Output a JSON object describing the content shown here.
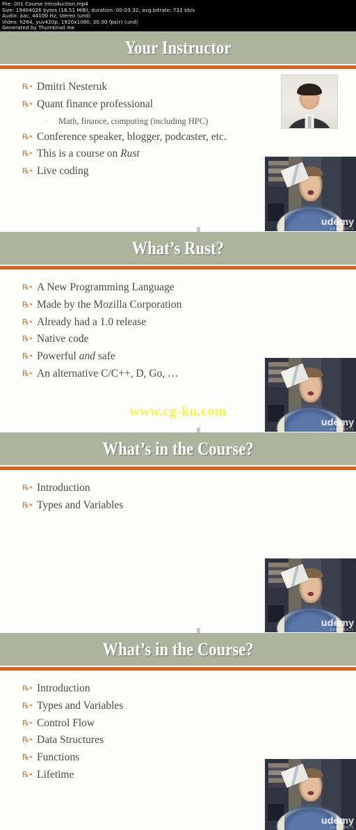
{
  "info_strip": {
    "lines": [
      "File: 001 Course Introduction.mp4",
      "Size: 19404026 bytes (18.51 MiB), duration: 00:03:32, avg.bitrate: 732 kb/s",
      "Audio: aac, 44100 Hz, stereo (und)",
      "Video: h264, yuv420p, 1920x1080, 30.00 fps(r) (und)",
      "Generated by Thumbnail me"
    ]
  },
  "theme": {
    "band_color": "#aeb39e",
    "accent_color": "#d9601e",
    "bullet_color": "#d2752f",
    "slide_bg": "#fdfdfb",
    "title_color": "#ffffff",
    "body_text_color": "#4a4a4a",
    "watermark_color": "#fbf24a"
  },
  "watermark": {
    "text": "www.cg-ku.com"
  },
  "slides": [
    {
      "title": "Your Instructor",
      "bullets": [
        {
          "level": 1,
          "text": "Dmitri Nesteruk"
        },
        {
          "level": 1,
          "text": "Quant finance professional"
        },
        {
          "level": 2,
          "text": "Math, finance, computing (including HPC)"
        },
        {
          "level": 1,
          "text": "Conference speaker, blogger, podcaster, etc."
        },
        {
          "level": 1,
          "text": "This is a course on ",
          "italic_tail": "Rust"
        },
        {
          "level": 1,
          "text": "Live coding"
        }
      ],
      "media": [
        {
          "kind": "headshot",
          "alt": "instructor-headshot"
        },
        {
          "kind": "webcam",
          "alt": "presenter-webcam",
          "watermark": "udemy",
          "watermark_sub": "DOCUMENTS"
        }
      ]
    },
    {
      "title": "What’s Rust?",
      "bullets": [
        {
          "level": 1,
          "text": "A New Programming Language"
        },
        {
          "level": 1,
          "text": "Made by the Mozilla Corporation"
        },
        {
          "level": 1,
          "text": "Already had a 1.0 release"
        },
        {
          "level": 1,
          "text": "Native code"
        },
        {
          "level": 1,
          "text": "Powerful ",
          "italic_tail": "and",
          "text_after": " safe"
        },
        {
          "level": 1,
          "text": "An alternative C/C++, D, Go, …"
        }
      ],
      "media": [
        {
          "kind": "webcam",
          "alt": "presenter-webcam",
          "watermark": "udemy",
          "watermark_sub": "DOCUMENTS"
        }
      ]
    },
    {
      "title": "What’s in the Course?",
      "bullets": [
        {
          "level": 1,
          "text": "Introduction"
        },
        {
          "level": 1,
          "text": "Types and Variables"
        }
      ],
      "media": [
        {
          "kind": "webcam",
          "alt": "presenter-webcam",
          "watermark": "udemy",
          "watermark_sub": "DOCUMENTS"
        }
      ]
    },
    {
      "title": "What’s in the Course?",
      "bullets": [
        {
          "level": 1,
          "text": "Introduction"
        },
        {
          "level": 1,
          "text": "Types and Variables"
        },
        {
          "level": 1,
          "text": "Control Flow"
        },
        {
          "level": 1,
          "text": "Data Structures"
        },
        {
          "level": 1,
          "text": "Functions"
        },
        {
          "level": 1,
          "text": "Lifetime"
        }
      ],
      "media": [
        {
          "kind": "webcam",
          "alt": "presenter-webcam",
          "watermark": "udemy",
          "watermark_sub": "DOCUMENTS"
        }
      ]
    }
  ]
}
